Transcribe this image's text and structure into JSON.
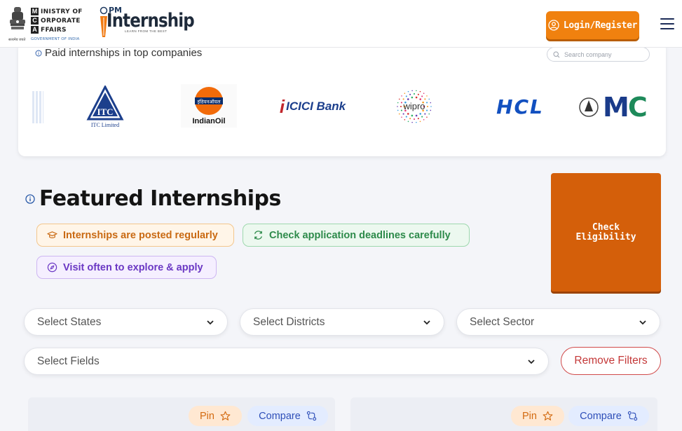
{
  "header": {
    "mca_lines": [
      {
        "letter": "M",
        "word": "INISTRY OF"
      },
      {
        "letter": "C",
        "word": "ORPORATE"
      },
      {
        "letter": "A",
        "word": "FFAIRS"
      }
    ],
    "gov_of_india": "GOVERNMENT OF INDIA",
    "emblem_caption": "सत्यमेव जयते",
    "pm_label": "PM",
    "internship_label": "Internship",
    "tagline": "LEARN FROM THE BEST",
    "login_label": "Login/Register"
  },
  "companies": {
    "heading": "Paid internships in top companies",
    "search_placeholder": "Search company",
    "logos": {
      "itc": "ITC Limited",
      "ioc_hindi": "इंडियनऑयल",
      "ioc": "IndianOil",
      "icici": "ICICI Bank",
      "wipro": "wipro",
      "hcl": "HCL",
      "mc_left": "M",
      "mc_right": "C"
    }
  },
  "featured": {
    "title": "Featured Internships",
    "chips": [
      "Internships are posted regularly",
      "Check application deadlines carefully",
      "Visit often to explore & apply"
    ],
    "check_eligibility_line1": "Check",
    "check_eligibility_line2": "Eligibility"
  },
  "filters": {
    "states": "Select States",
    "districts": "Select Districts",
    "sector": "Select Sector",
    "fields": "Select Fields",
    "remove_label": "Remove Filters"
  },
  "cards": [
    {
      "pin": "Pin",
      "compare": "Compare"
    },
    {
      "pin": "Pin",
      "compare": "Compare"
    }
  ],
  "colors": {
    "accent_orange": "#f0810f",
    "eligibility": "#d45f0a",
    "navy": "#1c2c58"
  }
}
